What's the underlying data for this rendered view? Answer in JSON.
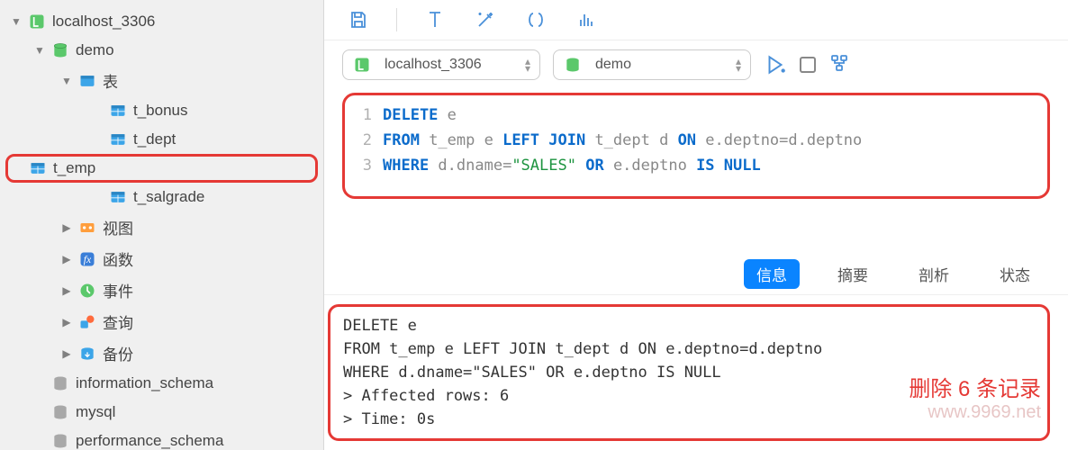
{
  "tree": {
    "connection": "localhost_3306",
    "db": "demo",
    "tables_label": "表",
    "tables": [
      "t_bonus",
      "t_dept",
      "t_emp",
      "t_salgrade"
    ],
    "selected_table": "t_emp",
    "nodes": {
      "views": "视图",
      "functions": "函数",
      "events": "事件",
      "queries": "查询",
      "backup": "备份"
    },
    "other_dbs": [
      "information_schema",
      "mysql",
      "performance_schema"
    ]
  },
  "combos": {
    "connection": "localhost_3306",
    "database": "demo"
  },
  "editor": {
    "lines": [
      {
        "n": 1,
        "segments": [
          {
            "t": "DELETE",
            "c": "kw"
          },
          {
            "t": " e",
            "c": ""
          }
        ]
      },
      {
        "n": 2,
        "segments": [
          {
            "t": "FROM",
            "c": "kw"
          },
          {
            "t": " t_emp e ",
            "c": ""
          },
          {
            "t": "LEFT JOIN",
            "c": "kw"
          },
          {
            "t": " t_dept d ",
            "c": ""
          },
          {
            "t": "ON",
            "c": "kw"
          },
          {
            "t": " e.deptno=d.deptno",
            "c": ""
          }
        ]
      },
      {
        "n": 3,
        "segments": [
          {
            "t": "WHERE",
            "c": "kw"
          },
          {
            "t": " d.dname=",
            "c": ""
          },
          {
            "t": "\"SALES\"",
            "c": "str"
          },
          {
            "t": " ",
            "c": ""
          },
          {
            "t": "OR",
            "c": "kw"
          },
          {
            "t": " e.deptno ",
            "c": ""
          },
          {
            "t": "IS NULL",
            "c": "kw"
          }
        ]
      }
    ]
  },
  "result_tabs": {
    "info": "信息",
    "summary": "摘要",
    "profile": "剖析",
    "status": "状态",
    "active": "信息"
  },
  "output": [
    "DELETE e",
    "FROM t_emp e LEFT JOIN t_dept d ON e.deptno=d.deptno",
    "WHERE d.dname=\"SALES\" OR e.deptno IS NULL",
    "> Affected rows: 6",
    "> Time: 0s"
  ],
  "annotation": {
    "note": "删除 6 条记录",
    "watermark": "www.9969.net"
  }
}
